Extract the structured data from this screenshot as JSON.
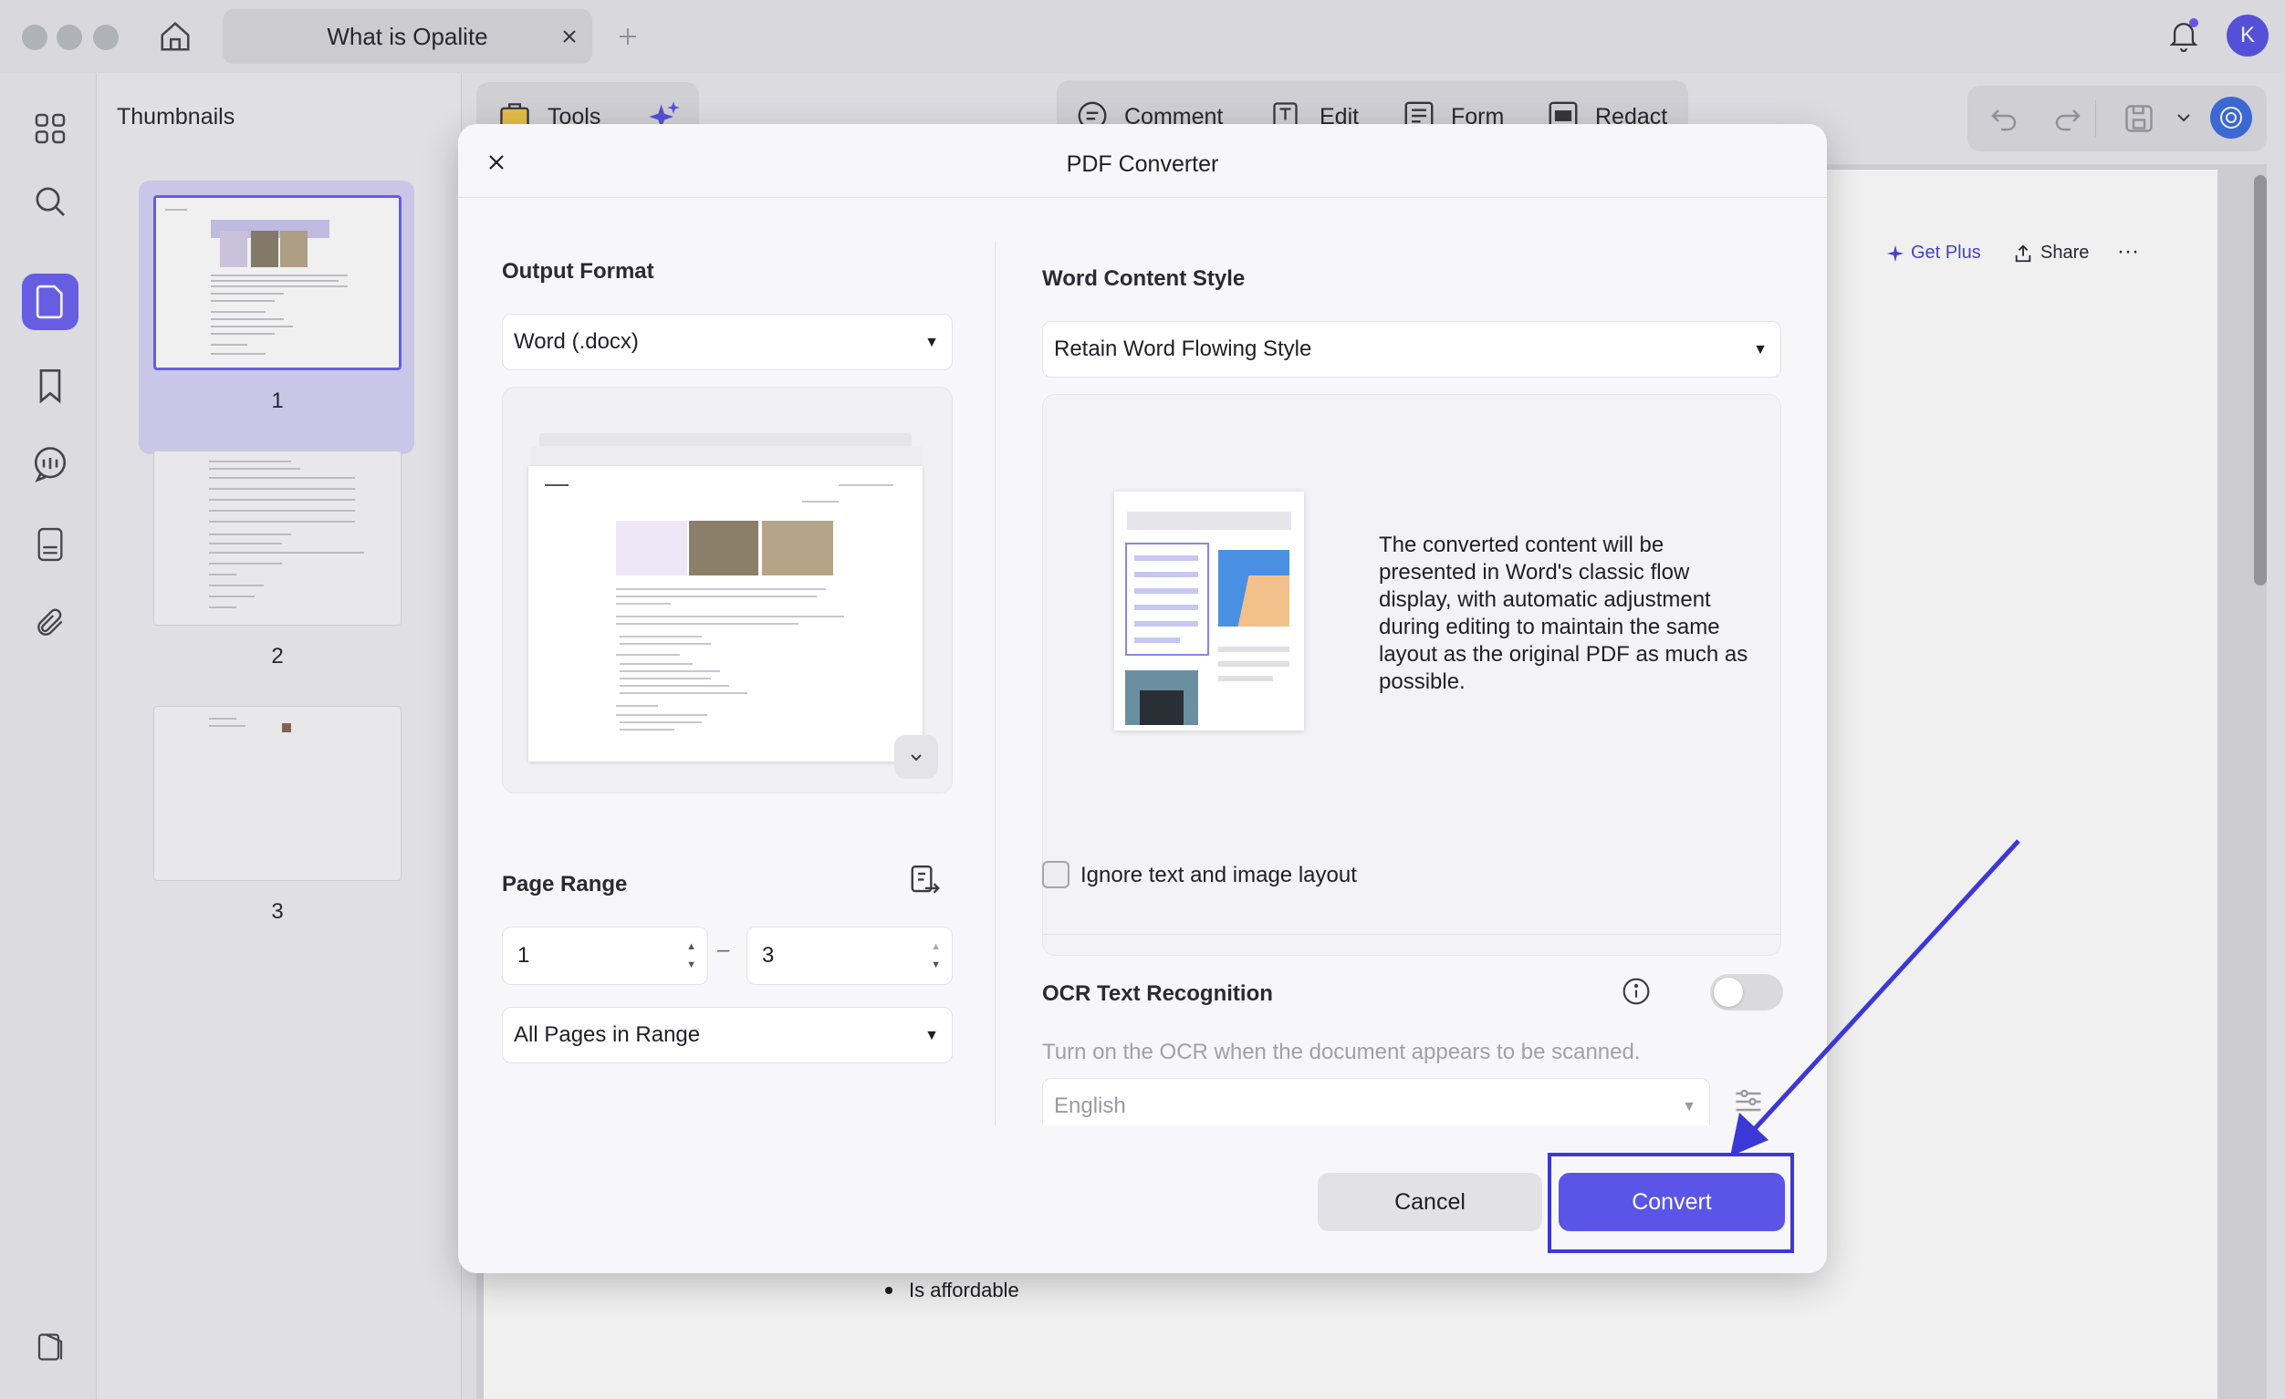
{
  "window": {
    "tab_title": "What is Opalite",
    "user_initial": "K"
  },
  "sidebar": {
    "items": [
      {
        "icon": "grid-icon"
      },
      {
        "icon": "search-icon"
      },
      {
        "icon": "page-icon",
        "active": true
      },
      {
        "icon": "bookmark-icon"
      },
      {
        "icon": "comment-icon"
      },
      {
        "icon": "document-icon"
      },
      {
        "icon": "attachment-icon"
      },
      {
        "icon": "layers-icon"
      }
    ]
  },
  "thumbnails": {
    "title": "Thumbnails",
    "pages": [
      "1",
      "2",
      "3"
    ]
  },
  "toolbar": {
    "tools_label": "Tools",
    "comment_label": "Comment",
    "edit_label": "Edit",
    "form_label": "Form",
    "redact_label": "Redact"
  },
  "document": {
    "get_plus": "Get Plus",
    "share": "Share",
    "more": "···",
    "bullet_text": "Is affordable"
  },
  "dialog": {
    "title": "PDF Converter",
    "output_format_label": "Output Format",
    "output_format_value": "Word (.docx)",
    "page_range_label": "Page Range",
    "range_from": "1",
    "range_to": "3",
    "range_dash": "–",
    "range_subset": "All Pages in Range",
    "word_style_label": "Word Content Style",
    "word_style_value": "Retain Word Flowing Style",
    "word_style_description": "The converted content will be presented in Word's classic flow display, with automatic adjustment during editing to maintain the same layout as the original PDF as much as possible.",
    "ignore_layout_label": "Ignore text and image layout",
    "ignore_layout_checked": false,
    "ocr_label": "OCR Text Recognition",
    "ocr_enabled": false,
    "ocr_hint": "Turn on the OCR when the document appears to be scanned.",
    "ocr_language": "English",
    "cancel_label": "Cancel",
    "convert_label": "Convert"
  },
  "colors": {
    "accent": "#5a55e6",
    "annotation": "#3c38d8"
  }
}
